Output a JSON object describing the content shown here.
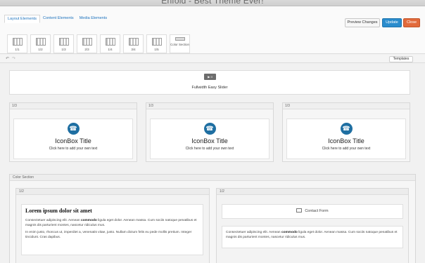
{
  "window": {
    "title": "Enfold - Best Theme Ever!"
  },
  "tabs": [
    {
      "label": "Layout Elements"
    },
    {
      "label": "Content Elements"
    },
    {
      "label": "Media Elements"
    }
  ],
  "actions": {
    "preview": "Preview Changes",
    "update": "Update",
    "close": "Close"
  },
  "elements": [
    {
      "label": "1/1"
    },
    {
      "label": "1/2"
    },
    {
      "label": "1/3"
    },
    {
      "label": "2/3"
    },
    {
      "label": "1/4"
    },
    {
      "label": "3/4"
    },
    {
      "label": "1/5"
    },
    {
      "label": "Color Section"
    }
  ],
  "editor": {
    "templates": "Templates",
    "undo": "↶",
    "redo": "↷"
  },
  "slider": {
    "icon_text": "▶ II",
    "name": "Fullwidth Easy Slider"
  },
  "columns": [
    {
      "size": "1/3",
      "title": "IconBox Title",
      "text": "Click here to add your own text"
    },
    {
      "size": "1/3",
      "title": "IconBox Title",
      "text": "Click here to add your own text"
    },
    {
      "size": "1/3",
      "title": "IconBox Title",
      "text": "Click here to add your own text"
    }
  ],
  "color_section": {
    "label": "Color Section"
  },
  "half_left": {
    "size": "1/2",
    "heading": "Lorem ipsum dolor sit amet",
    "p1_a": "Consectetuer adipiscing elit. Aenean ",
    "p1_bold": "commodo",
    "p1_b": " ligula eget dolor. Aenean massa. Cum sociis natoque penatibus et magnis dis parturient montes, nascetur ridiculus mus.",
    "p2": "In enim justo, rhoncus ut, imperdiet a, venenatis vitae, justo. Nullam dictum felis eu pede mollis pretium. Integer tincidunt. Cras dapibus."
  },
  "half_right": {
    "size": "1/2",
    "contact": "Contact Form",
    "p_a": "Consectetuer adipiscing elit. Aenean ",
    "p_bold": "commodo",
    "p_b": " ligula eget dolor. Aenean massa. Cum sociis natoque penatibus et magnis dis parturient montes, nascetur ridiculus mus."
  }
}
